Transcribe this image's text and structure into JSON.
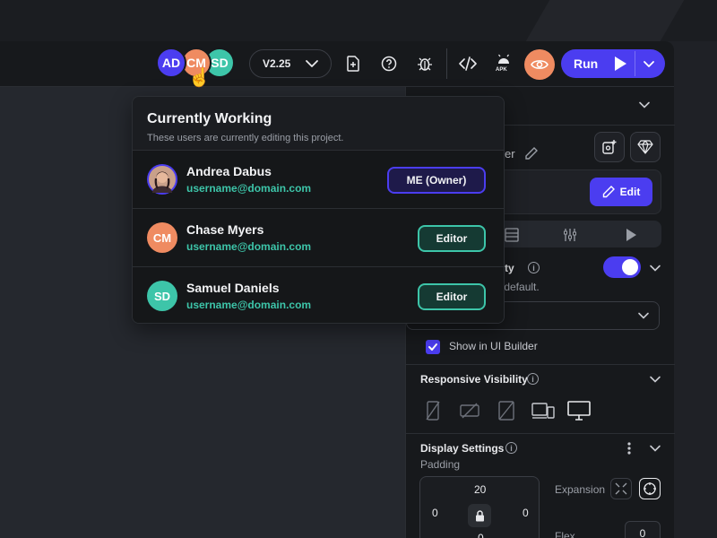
{
  "collaborators": {
    "avatars": [
      {
        "initials": "AD",
        "color": "#4b3df0"
      },
      {
        "initials": "CM",
        "color": "#ef8b61"
      },
      {
        "initials": "SD",
        "color": "#3dc5a9"
      }
    ]
  },
  "toolbar": {
    "version_label": "V2.25",
    "apk_label": "APK",
    "run_label": "Run",
    "icons": [
      "new-file-icon",
      "help-icon",
      "debug-icon",
      "code-icon",
      "android-apk-icon",
      "preview-eye-icon",
      "play-icon",
      "chevron-down-icon"
    ]
  },
  "popover": {
    "title": "Currently Working",
    "subtitle": "These users are currently editing this project.",
    "users": [
      {
        "name": "Andrea Dabus",
        "email": "username@domain.com",
        "role": "ME (Owner)",
        "avatar": "photo"
      },
      {
        "name": "Chase Myers",
        "email": "username@domain.com",
        "role": "Editor",
        "initials": "CM",
        "color": "#ef8b61"
      },
      {
        "name": "Samuel Daniels",
        "email": "username@domain.com",
        "role": "Editor",
        "initials": "SD",
        "color": "#3dc5a9"
      }
    ]
  },
  "panel": {
    "partial_name_suffix": "er",
    "edit_label": "Edit",
    "visibility_title_partial": "ility",
    "visibility_desc_partial": "y default.",
    "show_in_builder": "Show in UI Builder",
    "show_in_builder_checked": true,
    "visibility_toggle_on": true,
    "responsive_title": "Responsive Visibility",
    "display_title": "Display Settings",
    "padding_label": "Padding",
    "padding": {
      "top": "20",
      "left": "0",
      "right": "0",
      "bottom": "0"
    },
    "expansion_label": "Expansion",
    "flex_label": "Flex",
    "flex_value": "0"
  },
  "colors": {
    "accent": "#4b3df0",
    "teal": "#3dc5a9",
    "orange": "#ef8b61"
  }
}
